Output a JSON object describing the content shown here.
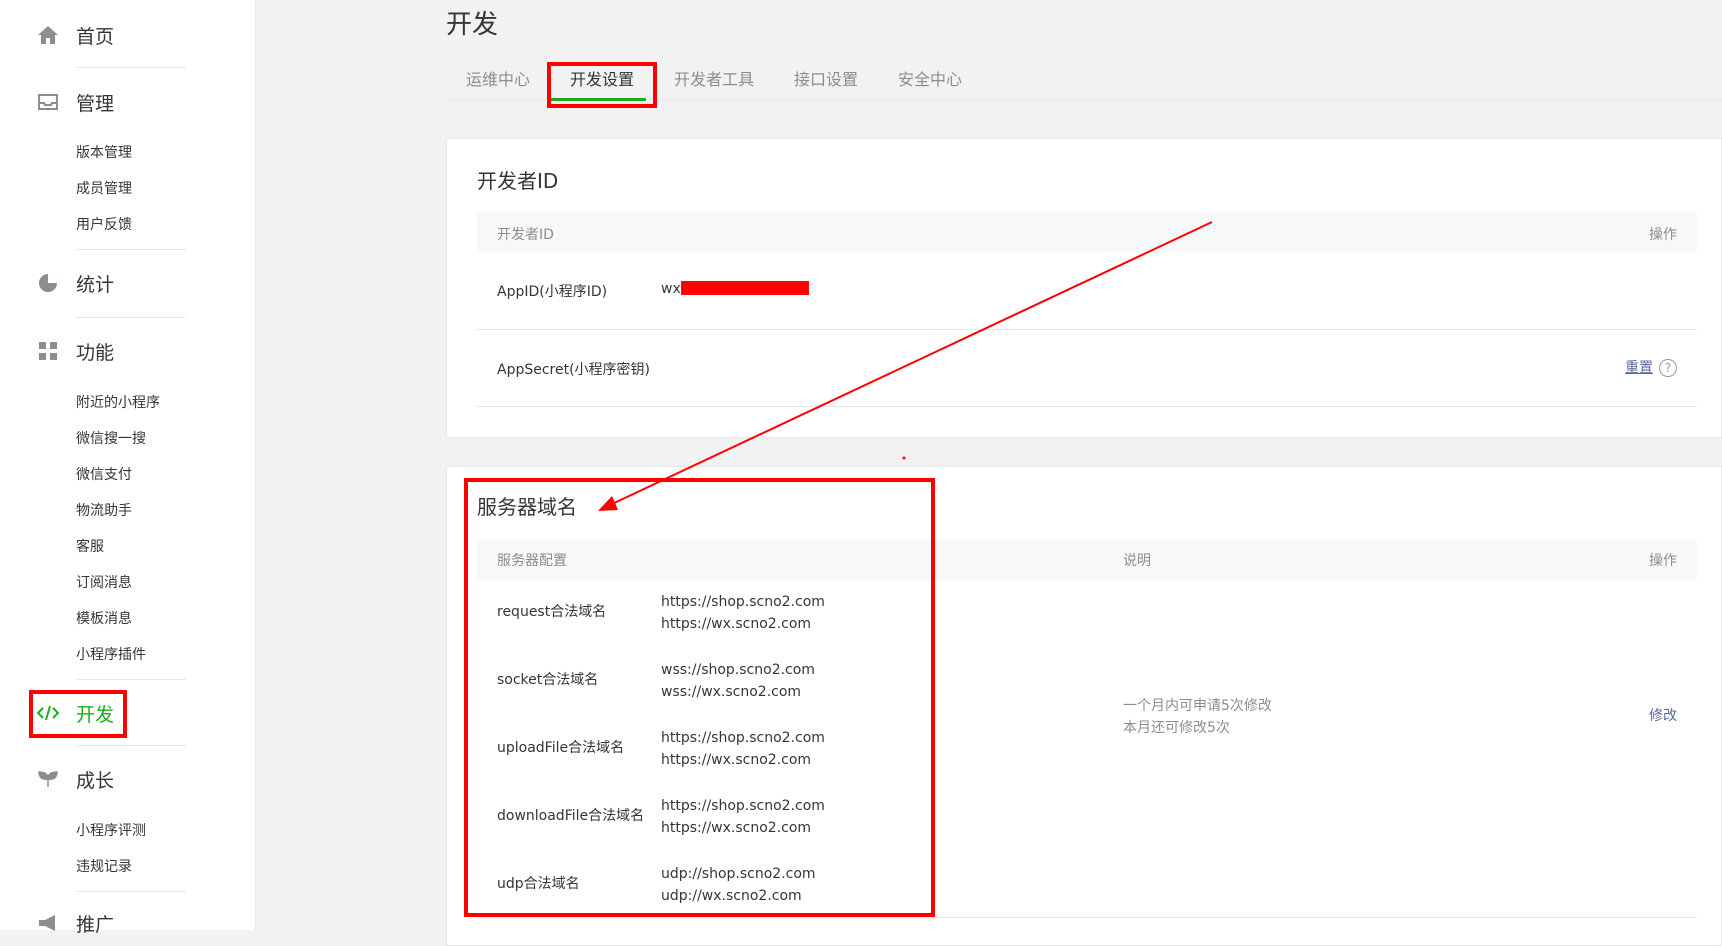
{
  "sidebar": {
    "home": "首页",
    "manage": "管理",
    "manage_items": [
      "版本管理",
      "成员管理",
      "用户反馈"
    ],
    "stats": "统计",
    "features": "功能",
    "feature_items": [
      "附近的小程序",
      "微信搜一搜",
      "微信支付",
      "物流助手",
      "客服",
      "订阅消息",
      "模板消息",
      "小程序插件"
    ],
    "develop": "开发",
    "growth": "成长",
    "growth_items": [
      "小程序评测",
      "违规记录"
    ],
    "promote": "推广"
  },
  "page_title": "开发",
  "tabs": [
    "运维中心",
    "开发设置",
    "开发者工具",
    "接口设置",
    "安全中心"
  ],
  "developer_id": {
    "title": "开发者ID",
    "col_name": "开发者ID",
    "col_action": "操作",
    "appid_label": "AppID(小程序ID)",
    "appid_prefix": "wx",
    "secret_label": "AppSecret(小程序密钥)",
    "reset_link": "重置",
    "help_glyph": "?"
  },
  "server_domain": {
    "title": "服务器域名",
    "col_config": "服务器配置",
    "col_desc": "说明",
    "col_action": "操作",
    "rows": [
      {
        "label": "request合法域名",
        "values": [
          "https://shop.scno2.com",
          "https://wx.scno2.com"
        ]
      },
      {
        "label": "socket合法域名",
        "values": [
          "wss://shop.scno2.com",
          "wss://wx.scno2.com"
        ]
      },
      {
        "label": "uploadFile合法域名",
        "values": [
          "https://shop.scno2.com",
          "https://wx.scno2.com"
        ]
      },
      {
        "label": "downloadFile合法域名",
        "values": [
          "https://shop.scno2.com",
          "https://wx.scno2.com"
        ]
      },
      {
        "label": "udp合法域名",
        "values": [
          "udp://shop.scno2.com",
          "udp://wx.scno2.com"
        ]
      }
    ],
    "desc_line1": "一个月内可申请5次修改",
    "desc_line2": "本月还可修改5次",
    "modify_link": "修改"
  },
  "colors": {
    "accent": "#1aad19",
    "annotation": "#ff0000",
    "link": "#576b95"
  }
}
